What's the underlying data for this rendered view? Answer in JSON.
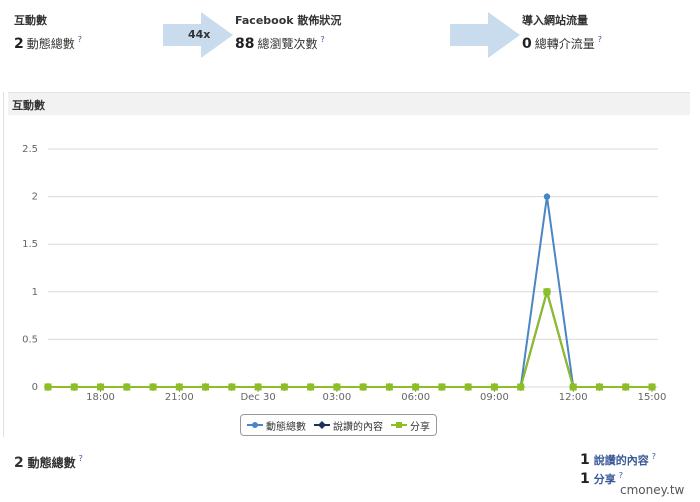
{
  "stats": {
    "interactions": {
      "title": "互動數",
      "number": "2",
      "label": "動態總數",
      "help": "?"
    },
    "growth": {
      "text": "44x"
    },
    "facebook": {
      "title": "Facebook 散佈狀況",
      "number": "88",
      "label": "總瀏覽次數",
      "help": "?"
    },
    "traffic": {
      "title": "導入網站流量",
      "number": "0",
      "label": "總轉介流量",
      "help": "?"
    }
  },
  "section": {
    "title": "互動數"
  },
  "chart_data": {
    "type": "line",
    "title": "",
    "xlabel": "",
    "ylabel": "",
    "ylim": [
      0,
      2.5
    ],
    "yticks": [
      "0",
      "0.5",
      "1",
      "1.5",
      "2",
      "2.5"
    ],
    "xticks": [
      "18:00",
      "21:00",
      "Dec 30",
      "03:00",
      "06:00",
      "09:00",
      "12:00",
      "15:00"
    ],
    "x_points": 24,
    "x_tick_indices": [
      2,
      5,
      8,
      11,
      14,
      17,
      20,
      23
    ],
    "grid": true,
    "legend_position": "bottom-center",
    "series": [
      {
        "name": "動態總數",
        "color": "#4a86c5",
        "marker": "circle",
        "values": [
          0,
          0,
          0,
          0,
          0,
          0,
          0,
          0,
          0,
          0,
          0,
          0,
          0,
          0,
          0,
          0,
          0,
          0,
          0,
          2,
          0,
          0,
          0,
          0
        ]
      },
      {
        "name": "說讚的內容",
        "color": "#1c2f5e",
        "marker": "diamond",
        "values": [
          0,
          0,
          0,
          0,
          0,
          0,
          0,
          0,
          0,
          0,
          0,
          0,
          0,
          0,
          0,
          0,
          0,
          0,
          0,
          1,
          0,
          0,
          0,
          0
        ]
      },
      {
        "name": "分享",
        "color": "#8cbf26",
        "marker": "square",
        "values": [
          0,
          0,
          0,
          0,
          0,
          0,
          0,
          0,
          0,
          0,
          0,
          0,
          0,
          0,
          0,
          0,
          0,
          0,
          0,
          1,
          0,
          0,
          0,
          0
        ]
      }
    ]
  },
  "legend": {
    "items": [
      {
        "label": "動態總數",
        "color": "#4a86c5"
      },
      {
        "label": "說讚的內容",
        "color": "#1c2f5e"
      },
      {
        "label": "分享",
        "color": "#8cbf26"
      }
    ]
  },
  "bottom": {
    "left": {
      "number": "2",
      "label": "動態總數",
      "help": "?"
    },
    "right": [
      {
        "number": "1",
        "label": "說讚的內容",
        "help": "?"
      },
      {
        "number": "1",
        "label": "分享",
        "help": "?"
      }
    ]
  },
  "watermark": "cmoney.tw"
}
